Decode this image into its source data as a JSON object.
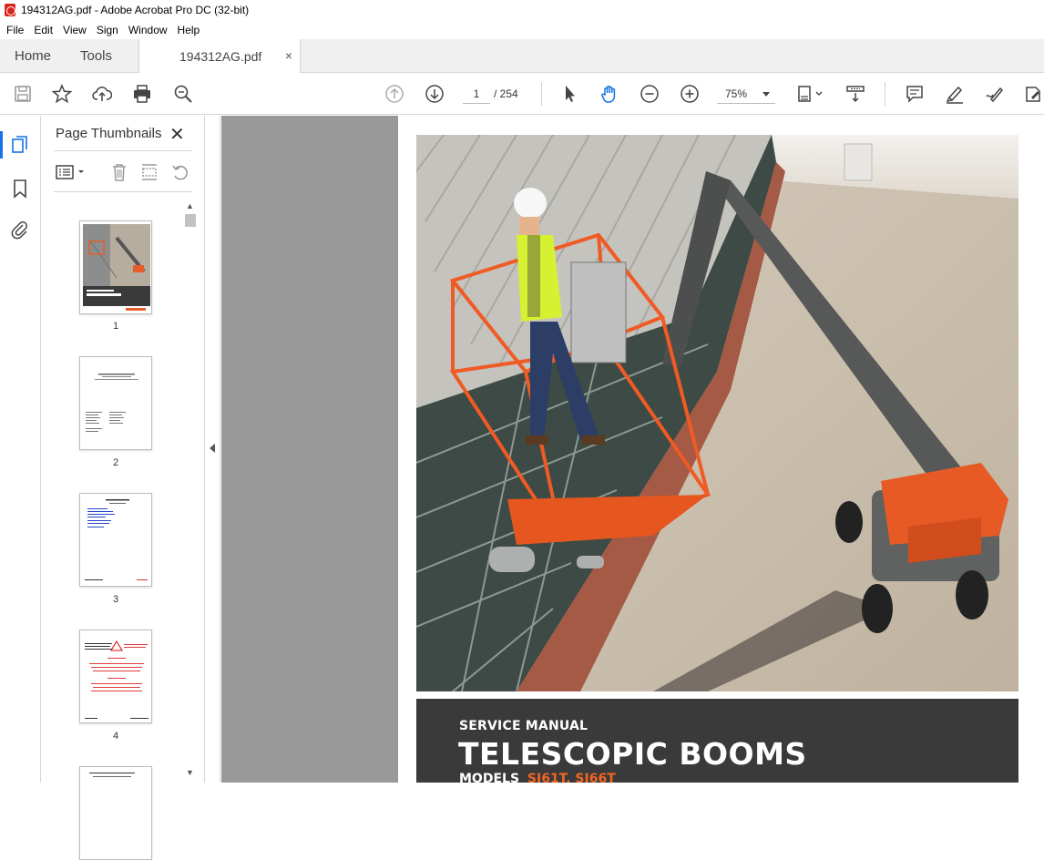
{
  "window": {
    "title": "194312AG.pdf - Adobe Acrobat Pro DC (32-bit)"
  },
  "menu": [
    "File",
    "Edit",
    "View",
    "Sign",
    "Window",
    "Help"
  ],
  "tabs": {
    "home": "Home",
    "tools": "Tools",
    "doc": "194312AG.pdf",
    "close": "×"
  },
  "toolbar": {
    "page_current": "1",
    "page_total": "/ 254",
    "zoom": "75%"
  },
  "panel": {
    "title": "Page Thumbnails",
    "close": "✕",
    "thumbnails": [
      {
        "num": "1"
      },
      {
        "num": "2"
      },
      {
        "num": "3"
      },
      {
        "num": "4"
      }
    ]
  },
  "cover": {
    "service": "SERVICE MANUAL",
    "title": "TELESCOPIC BOOMS",
    "models_label": "MODELS",
    "models": "SJ61T, SJ66T"
  },
  "colors": {
    "accent": "#1473e6",
    "brand_orange": "#f26522",
    "banner": "#3b3a3a",
    "pdf_red": "#d9261c"
  }
}
